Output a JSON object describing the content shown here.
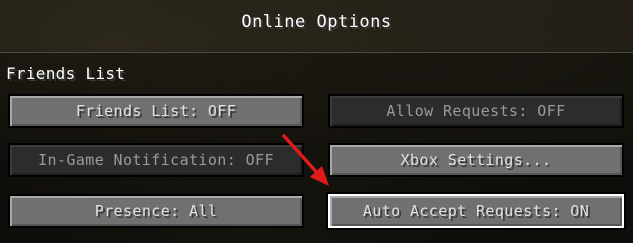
{
  "screen_title": "Online Options",
  "section_label": "Friends List",
  "buttons": {
    "friends_list": {
      "label": "Friends List: OFF",
      "enabled": true
    },
    "allow_requests": {
      "label": "Allow Requests: OFF",
      "enabled": false
    },
    "in_game_notification": {
      "label": "In-Game Notification: OFF",
      "enabled": false
    },
    "xbox_settings": {
      "label": "Xbox Settings...",
      "enabled": true
    },
    "presence": {
      "label": "Presence: All",
      "enabled": true
    },
    "auto_accept_requests": {
      "label": "Auto Accept Requests: ON",
      "enabled": true,
      "highlighted": true
    }
  },
  "annotation": {
    "arrow_color": "#e01b1b",
    "points_to": "auto_accept_requests"
  }
}
